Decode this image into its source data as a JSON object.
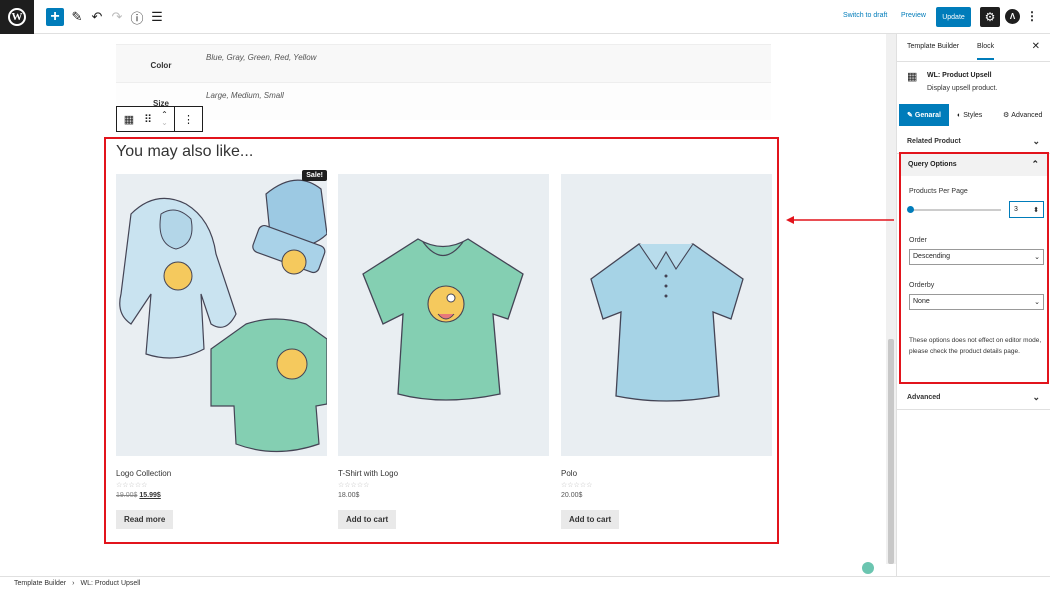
{
  "topbar": {
    "switch_to_draft": "Switch to draft",
    "preview": "Preview",
    "update": "Update",
    "add_symbol": "+",
    "wp_symbol": "W",
    "astra_symbol": "Λ"
  },
  "attributes": [
    {
      "key": "Color",
      "value": "Blue, Gray, Green, Red, Yellow"
    },
    {
      "key": "Size",
      "value": "Large, Medium, Small"
    }
  ],
  "upsell": {
    "title": "You may also like...",
    "sale_badge": "Sale!",
    "products": [
      {
        "name": "Logo Collection",
        "stars": "☆☆☆☆☆",
        "old_price": "19.00$",
        "price": "15.99$",
        "button": "Read more"
      },
      {
        "name": "T-Shirt with Logo",
        "stars": "☆☆☆☆☆",
        "price": "18.00$",
        "button": "Add to cart"
      },
      {
        "name": "Polo",
        "stars": "☆☆☆☆☆",
        "price": "20.00$",
        "button": "Add to cart"
      }
    ]
  },
  "sidebar": {
    "tabs": [
      "Template Builder",
      "Block"
    ],
    "close": "✕",
    "block_name": "WL: Product Upsell",
    "block_desc": "Display upsell product.",
    "subtabs": [
      "Genaral",
      "Styles",
      "Advanced"
    ],
    "related_product": "Related Product",
    "query_options": "Query Options",
    "products_per_page_label": "Products Per Page",
    "products_per_page": "3",
    "slider_fraction": 0.0,
    "order_label": "Order",
    "order_value": "Descending",
    "orderby_label": "Orderby",
    "orderby_value": "None",
    "note": "These options does not effect on editor mode, please check the product details page.",
    "advanced": "Advanced"
  },
  "breadcrumb": {
    "root": "Template Builder",
    "separator": "›",
    "current": "WL: Product Upsell"
  },
  "colors": {
    "accent": "#007cba",
    "highlight": "#e2141c"
  }
}
